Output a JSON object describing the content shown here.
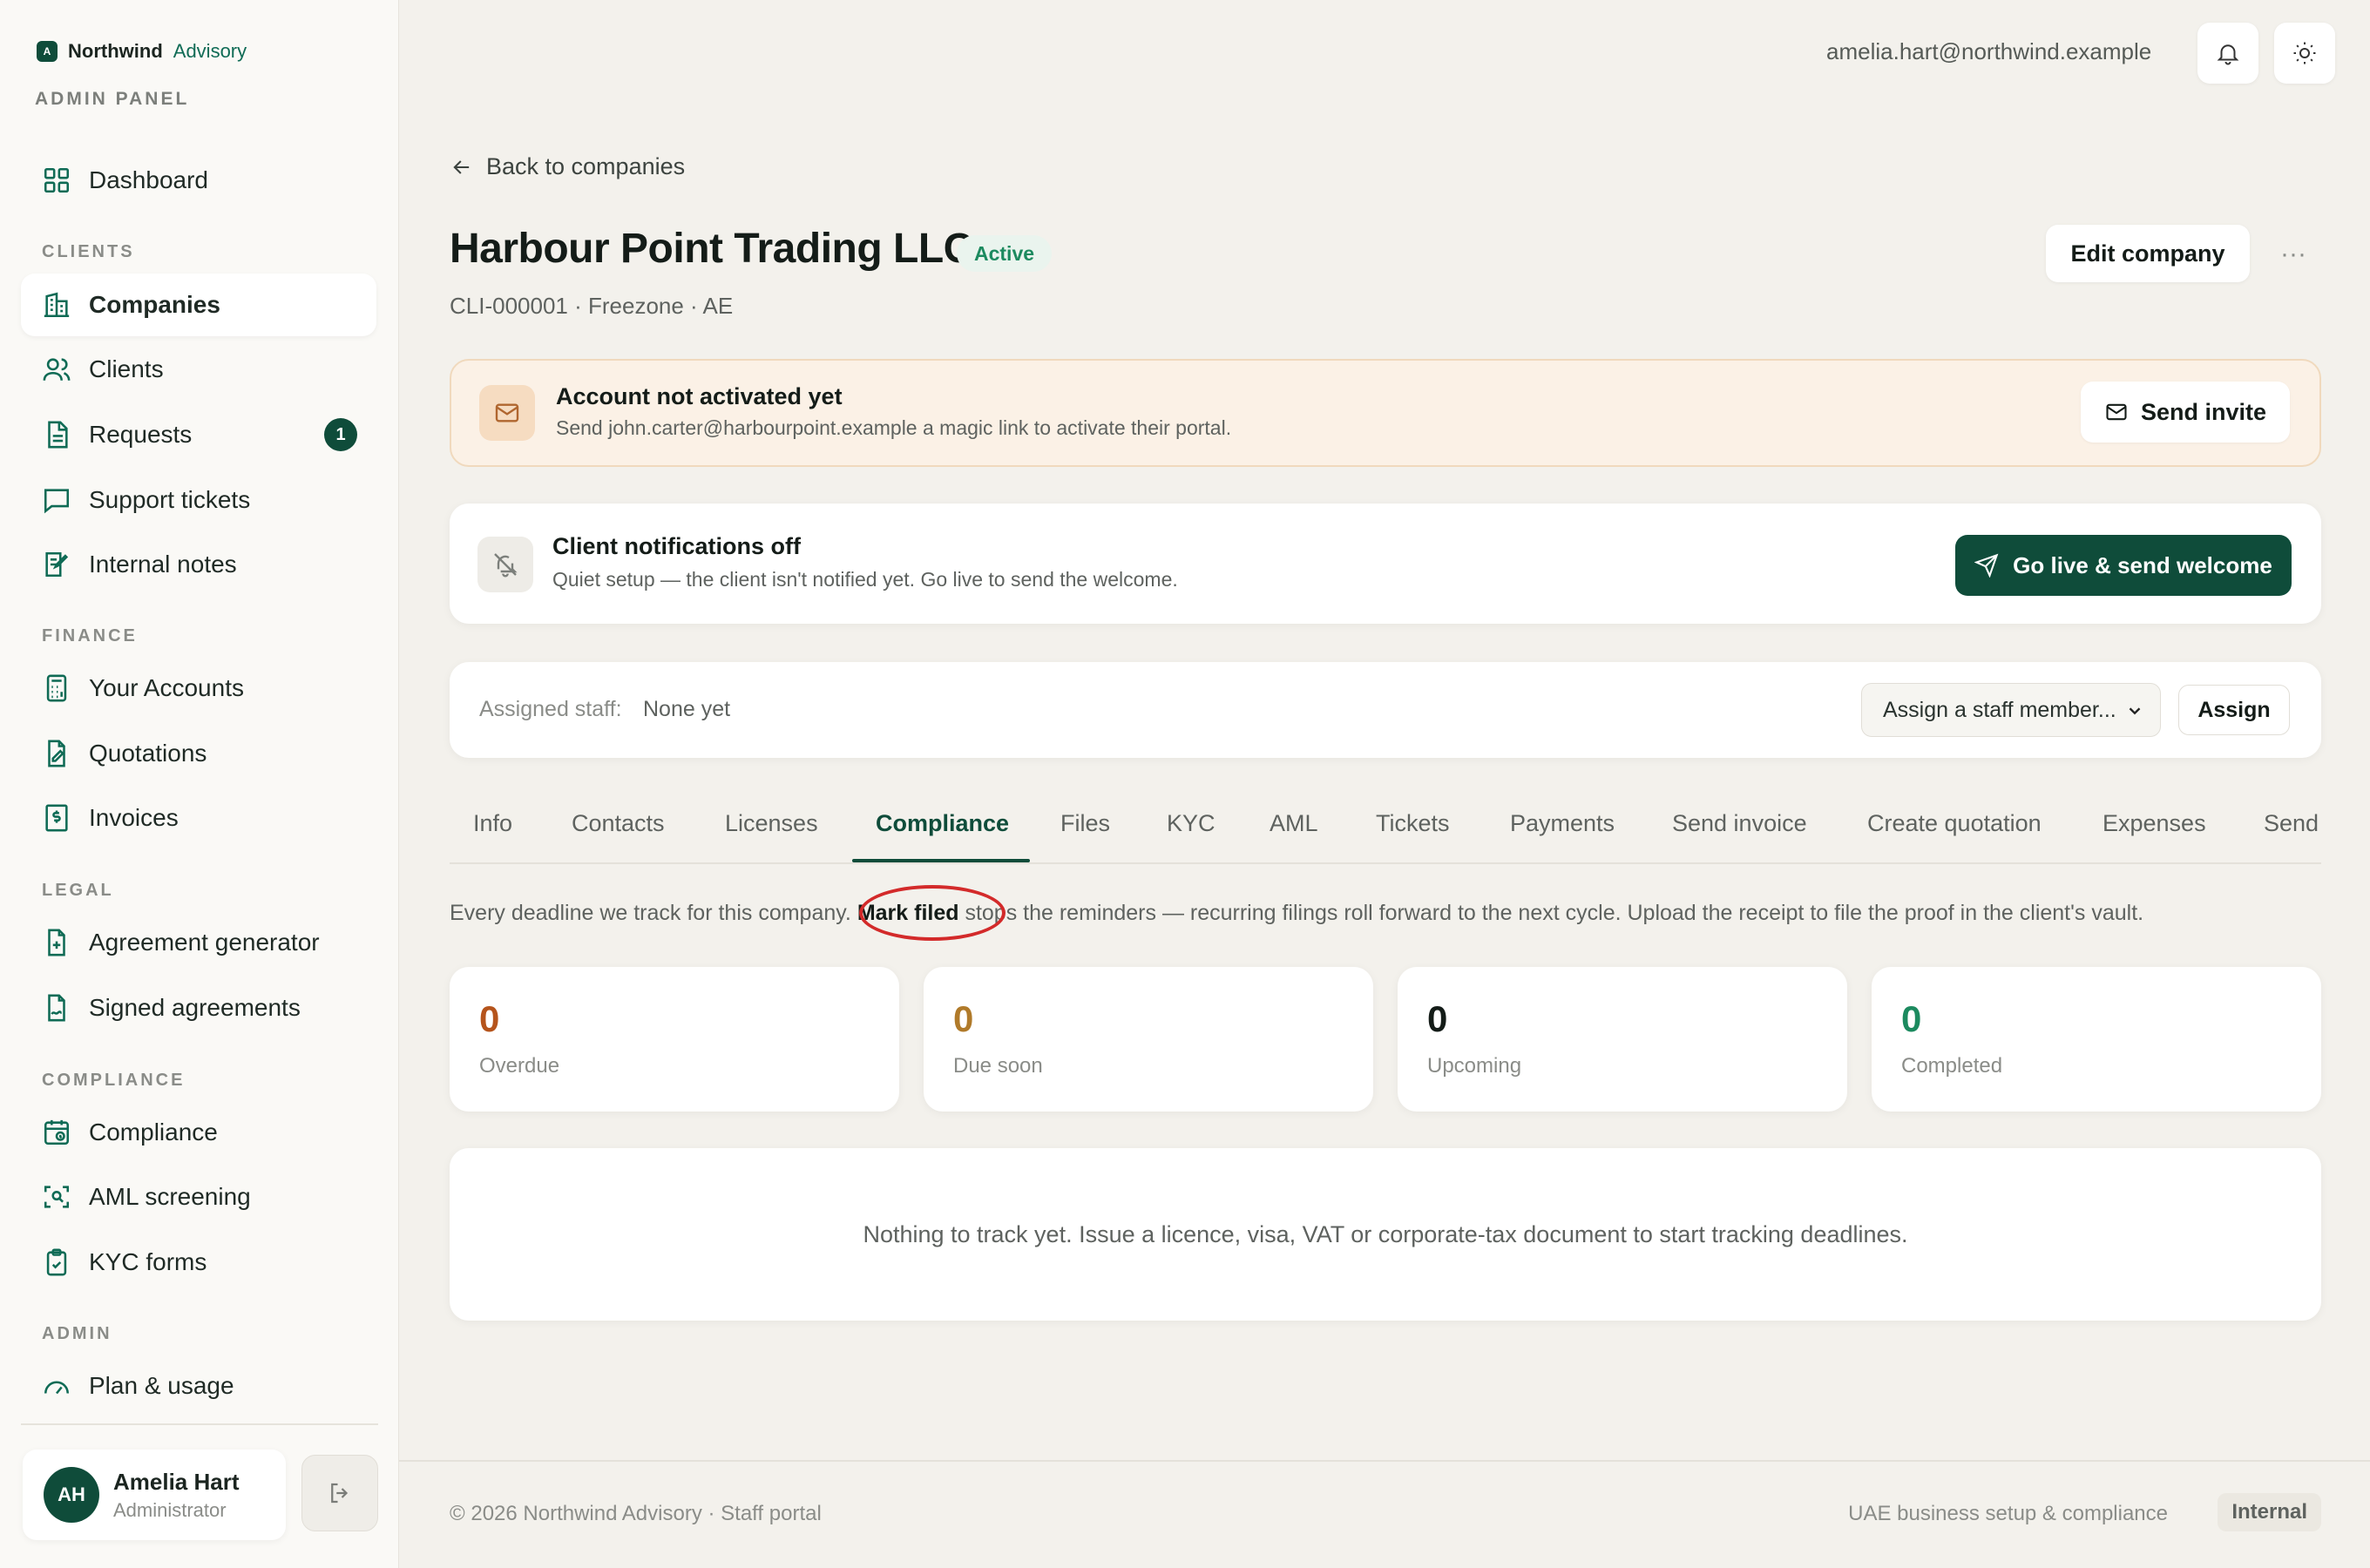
{
  "brand": {
    "name": "Northwind",
    "accent": "Advisory",
    "logo_letter": "A",
    "panel_label": "ADMIN PANEL"
  },
  "nav": {
    "dashboard": "Dashboard",
    "sections": {
      "clients": "CLIENTS",
      "finance": "FINANCE",
      "legal": "LEGAL",
      "compliance": "COMPLIANCE",
      "admin": "ADMIN"
    },
    "items": {
      "companies": "Companies",
      "clients": "Clients",
      "requests": "Requests",
      "requests_badge": "1",
      "support": "Support tickets",
      "notes": "Internal notes",
      "accounts": "Your Accounts",
      "quotations": "Quotations",
      "invoices": "Invoices",
      "agreement_generator": "Agreement generator",
      "signed_agreements": "Signed agreements",
      "compliance": "Compliance",
      "aml": "AML screening",
      "kyc": "KYC forms",
      "plan": "Plan & usage"
    },
    "active": "Companies"
  },
  "user": {
    "initials": "AH",
    "name": "Amelia Hart",
    "role": "Administrator",
    "email": "amelia.hart@northwind.example"
  },
  "page": {
    "back": "Back to companies",
    "title": "Harbour Point Trading LLC",
    "status": "Active",
    "meta": "CLI-000001 · Freezone · AE",
    "edit": "Edit company",
    "more": "···"
  },
  "activation_banner": {
    "title": "Account not activated yet",
    "text": "Send john.carter@harbourpoint.example a magic link to activate their portal.",
    "button": "Send invite"
  },
  "notify_banner": {
    "title": "Client notifications off",
    "text": "Quiet setup — the client isn't notified yet. Go live to send the welcome.",
    "button": "Go live & send welcome"
  },
  "staff": {
    "label": "Assigned staff:",
    "value": "None yet",
    "select_placeholder": "Assign a staff member...",
    "assign": "Assign"
  },
  "tabs": [
    "Info",
    "Contacts",
    "Licenses",
    "Compliance",
    "Files",
    "KYC",
    "AML",
    "Tickets",
    "Payments",
    "Send invoice",
    "Create quotation",
    "Expenses",
    "Send"
  ],
  "active_tab": "Compliance",
  "intro": {
    "before": "Every deadline we track for this company. ",
    "highlight": "Mark filed",
    "after": " stops the reminders — recurring filings roll forward to the next cycle. Upload the receipt to file the proof in the client's vault."
  },
  "stats": [
    {
      "value": "0",
      "label": "Overdue",
      "color": "#b5541c"
    },
    {
      "value": "0",
      "label": "Due soon",
      "color": "#b07a2a"
    },
    {
      "value": "0",
      "label": "Upcoming",
      "color": "#141c18"
    },
    {
      "value": "0",
      "label": "Completed",
      "color": "#1c8a5f"
    }
  ],
  "empty_state": "Nothing to track yet. Issue a licence, visa, VAT or corporate-tax document to start tracking deadlines.",
  "footer": {
    "left": "© 2026 Northwind Advisory · Staff portal",
    "right": "UAE business setup & compliance",
    "tag": "Internal"
  },
  "colors": {
    "brand": "#0f4c3a",
    "accent": "#0f6b55",
    "annotation": "#d32a2a"
  }
}
